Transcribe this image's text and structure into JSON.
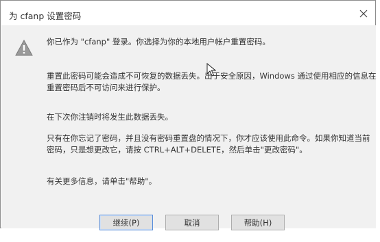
{
  "dialog": {
    "title": "为 cfanp 设置密码",
    "close_glyph": "×"
  },
  "message": {
    "line1": "你已作为 \"cfanp\" 登录。你选择为你的本地用户帐户重置密码。",
    "line2": "重置此密码可能会造成不可恢复的数据丢失。出于安全原因，Windows 通过使用相应的信息在",
    "line3": "重置密码后不可访问来进行保护。",
    "line4": "在下次你注销时将发生此数据丢失。",
    "line5": "只有在你忘记了密码，并且没有密码重置盘的情况下，你才应该使用此命令。如果你知道当前",
    "line6": "密码，只是想更改它，请按 CTRL+ALT+DELETE，然后单击\"更改密码\"。",
    "line7": "有关更多信息，请单击\"帮助\"。"
  },
  "buttons": {
    "continue": "继续(P)",
    "cancel": "取消",
    "help": "帮助(H)"
  },
  "icons": {
    "warning": "warning-icon",
    "close": "close-icon",
    "cursor": "mouse-cursor-icon"
  },
  "colors": {
    "content_bg": "#f1f1f1",
    "button_bg": "#e1e1e1",
    "default_button_border": "#5a8ed8"
  }
}
